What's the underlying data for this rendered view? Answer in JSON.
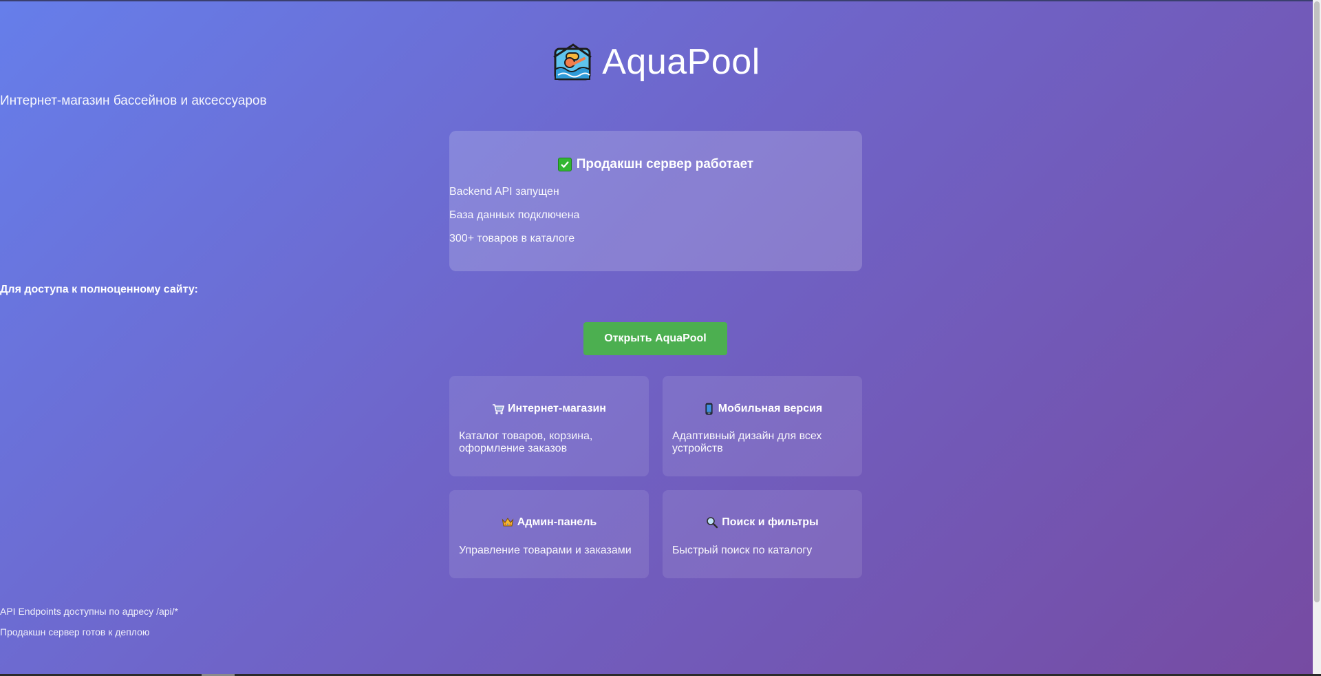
{
  "header": {
    "title": "AquaPool",
    "subtitle": "Интернет-магазин бассейнов и аксессуаров",
    "icon": "swimmer-icon"
  },
  "status": {
    "title": "Продакшн сервер работает",
    "icon": "check-mark-icon",
    "lines": [
      "Backend API запущен",
      "База данных подключена",
      "300+ товаров в каталоге"
    ]
  },
  "access": {
    "label": "Для доступа к полноценному сайту:",
    "button_label": "Открыть AquaPool"
  },
  "features": [
    {
      "icon": "shopping-cart-icon",
      "title": "Интернет-магазин",
      "desc": "Каталог товаров, корзина, оформление заказов"
    },
    {
      "icon": "mobile-phone-icon",
      "title": "Мобильная версия",
      "desc": "Адаптивный дизайн для всех устройств"
    },
    {
      "icon": "crown-icon",
      "title": "Админ-панель",
      "desc": "Управление товарами и заказами"
    },
    {
      "icon": "magnifier-icon",
      "title": "Поиск и фильтры",
      "desc": "Быстрый поиск по каталогу"
    }
  ],
  "footer": {
    "line1": "API Endpoints доступны по адресу /api/*",
    "line2": "Продакшн сервер готов к деплою"
  },
  "colors": {
    "gradient_start": "#667eea",
    "gradient_end": "#764ba2",
    "button": "#4caf50",
    "check": "#31b631"
  }
}
